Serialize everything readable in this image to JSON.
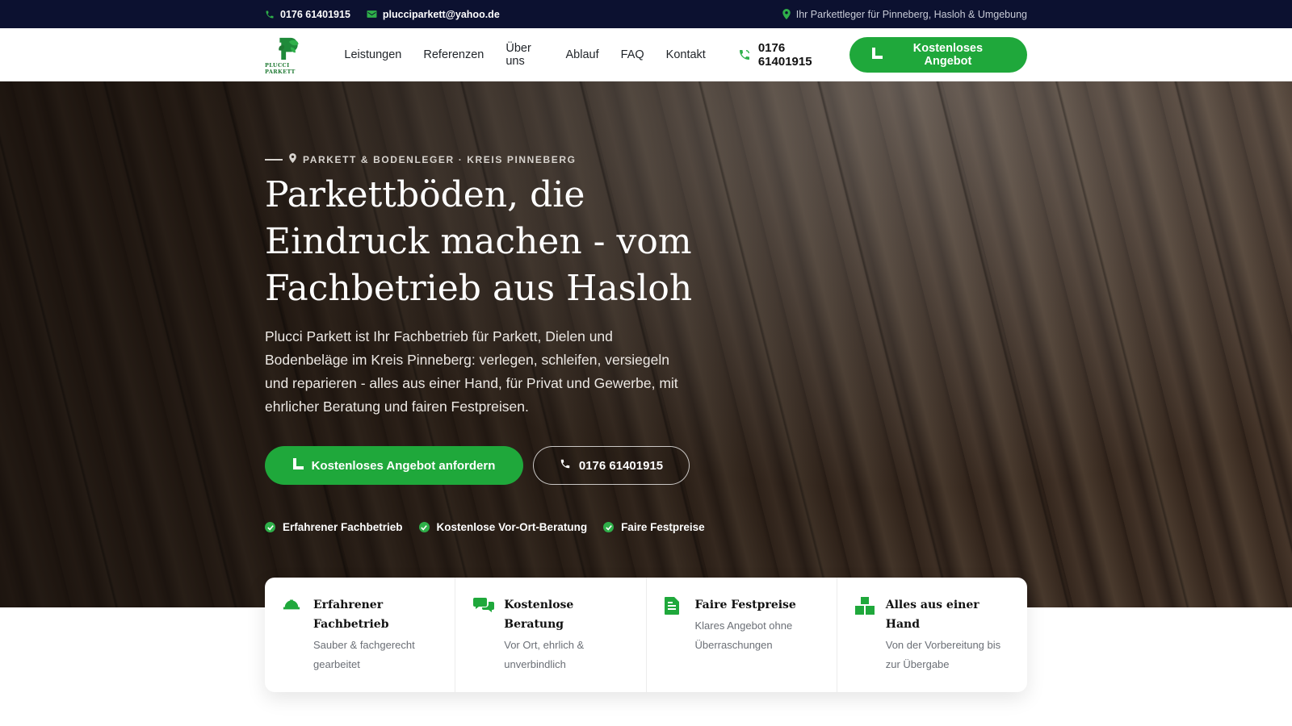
{
  "topbar": {
    "phone": "0176 61401915",
    "email": "plucciparkett@yahoo.de",
    "tagline": "Ihr Parkettleger für Pinneberg, Hasloh & Umgebung"
  },
  "nav": {
    "logo_text": "PLUCCI PARKETT",
    "menu": [
      "Leistungen",
      "Referenzen",
      "Über uns",
      "Ablauf",
      "FAQ",
      "Kontakt"
    ],
    "phone": "0176 61401915",
    "cta": "Kostenloses Angebot"
  },
  "hero": {
    "eyebrow": "PARKETT & BODENLEGER · KREIS PINNEBERG",
    "headline": "Parkettböden, die Eindruck machen - vom Fachbetrieb aus Hasloh",
    "lead": "Plucci Parkett ist Ihr Fachbetrieb für Parkett, Dielen und Bodenbeläge im Kreis Pinneberg: verlegen, schleifen, versiegeln und reparieren - alles aus einer Hand, für Privat und Gewerbe, mit ehrlicher Beratung und fairen Festpreisen.",
    "cta_primary": "Kostenloses Angebot anfordern",
    "cta_phone": "0176 61401915",
    "checks": [
      "Erfahrener Fachbetrieb",
      "Kostenlose Vor-Ort-Beratung",
      "Faire Festpreise"
    ]
  },
  "features": [
    {
      "icon": "hard-hat-icon",
      "title": "Erfahrener Fachbetrieb",
      "text": "Sauber & fachgerecht gearbeitet"
    },
    {
      "icon": "chat-bubbles-icon",
      "title": "Kostenlose Beratung",
      "text": "Vor Ort, ehrlich & unverbindlich"
    },
    {
      "icon": "document-icon",
      "title": "Faire Festpreise",
      "text": "Klares Angebot ohne Überraschungen"
    },
    {
      "icon": "boxes-icon",
      "title": "Alles aus einer Hand",
      "text": "Von der Vorbereitung bis zur Übergabe"
    }
  ],
  "colors": {
    "brand_green": "#1fa83b",
    "topbar_bg": "#0c1130"
  }
}
